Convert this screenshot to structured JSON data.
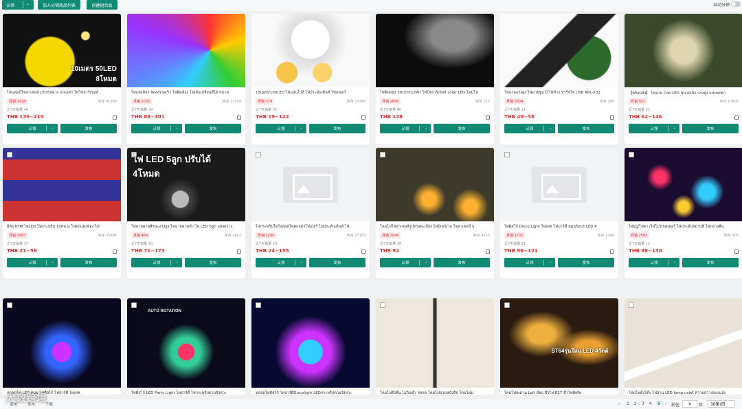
{
  "toolbar": {
    "claim_label": "认领",
    "add_label": "加入分销商品列表",
    "create_label": "创建组合品",
    "auto_label": "自动分销"
  },
  "card_labels": {
    "claim": "认领",
    "publish": "发布",
    "stock_prefix": "库存 ",
    "sold_prefix": "近7天销量 "
  },
  "cards": [
    {
      "title": "ไฟแคมป์โซล่าเซลล์ LED50ดวง 10เมตร ไฟโซลาร์เซลล์",
      "tag": "月销 1328",
      "stock": "41388",
      "sold": "40",
      "price": "THB 139~215",
      "img": "solar-lights",
      "ov": "10เมตร 50LED 8โหมด",
      "bg": "#111"
    },
    {
      "title": "ไฟแต่งห้อง จัดส่งรวดเร็ว ไฟติดห้อง ไฟเส้นเปลี่ยนสีได้ ขนาด",
      "tag": "月销 2035",
      "stock": "21924",
      "sold": "39",
      "price": "THB 88~301",
      "img": "led-strip",
      "ov": "",
      "bg": "#f4f4f4"
    },
    {
      "title": "15เมตร/100LED ไฟแอ่นไวท์ ไฟประดับเต็นท์ ไฟแคมป์",
      "tag": "月销 379",
      "stock": "20394",
      "sold": "35",
      "price": "THB 19~122",
      "img": "ball-lights",
      "ov": "",
      "bg": "#f8f8f8"
    },
    {
      "title": "ไฟติดผนัง 30LED(12W) ไฟโซลาร์เซลล์ solar LED โคมไฟ",
      "tag": "月销 2685",
      "stock": "125",
      "sold": "80",
      "price": "THB 138",
      "img": "wall-light",
      "ov": "",
      "bg": "#0c0c0c"
    },
    {
      "title": "ไฟฉายแรงสูง ไฟฉายซูม มี ไฟข้าง ชาร์จไฟ USB APL-X32",
      "tag": "月销 2304",
      "stock": "288",
      "sold": "11",
      "price": "THB 49~58",
      "img": "flashlight",
      "ov": "",
      "bg": "#fafafa"
    },
    {
      "title": "【พร้อมส่ง】 ไฟฉาย Cob LED ขนาดเล็ก แรงสูง แบบพกพา",
      "tag": "月销 921",
      "stock": "17800",
      "sold": "21",
      "price": "THB 62~146",
      "img": "cob-light",
      "ov": "",
      "bg": "#3b4a2a"
    },
    {
      "title": "ยี่ห้อ KTM ไฟLED ไฟกระพริบ 100ดวง ไฟตกแต่งห้อง ไฟ",
      "tag": "月销 2067",
      "stock": "35896",
      "sold": "37",
      "price": "THB 21~58",
      "img": "fairy-boxes",
      "ov": "",
      "bg": "#2a1a33"
    },
    {
      "title": "ไฟฉายคาดศีรษะแรงสูง ไฟฉายคาดหัว ไฟ LED 5ลูก แสงสว่าง",
      "tag": "月销 464",
      "stock": "2601",
      "sold": "10",
      "price": "THB 71~173",
      "img": "headlamp",
      "ov": "ไฟ LED 5ลูก ปรับได้ 4โหมด",
      "bg": "#1a1a1a"
    },
    {
      "title": "ไฟกระพริบไฟวิ่งหยดไฟตกแต่งไฟเธอรี่ ไฟประดับเต็นท์ ไฟ",
      "tag": "月销 1290",
      "stock": "27183",
      "sold": "59",
      "price": "THB 24~155",
      "img": "placeholder",
      "ov": "",
      "bg": ""
    },
    {
      "title": "โคมไฟโซล่าเซลล์รูปทรงตะเกียง ไฟปักสนาม โซลาเซลล์ S",
      "tag": "月销 1046",
      "stock": "4555",
      "sold": "28",
      "price": "THB 92",
      "img": "lantern",
      "ov": "",
      "bg": "#3d3a2a"
    },
    {
      "title": "ไฟดิสโก้ Disco Light ไฟเทค ไฟปาร์ตี้ หมุนร้อนร LED P",
      "tag": "月销 1732",
      "stock": "1246",
      "sold": "91",
      "price": "THB 96~121",
      "img": "placeholder",
      "ov": "",
      "bg": ""
    },
    {
      "title": "ไทยฎู/ไฟดาวไฟโปรเจคเตอร์ ไฟประดับสถานที่ ไฟกลางคืน",
      "tag": "月销 2563",
      "stock": "500",
      "sold": "11",
      "price": "THB 88~130",
      "img": "star-projector",
      "ov": "",
      "bg": "#1a0b30"
    },
    {
      "title": "หลอดไฟ LED หมุน ไฟดิสโก้ ไฟปาร์ตี้ ไฟเทค",
      "tag": "",
      "stock": "",
      "sold": "",
      "price": "",
      "img": "disco-bulb",
      "ov": "",
      "bg": "#0a0820"
    },
    {
      "title": "ไฟดิสโก้ LED Party Light ไฟปาร์ตี้ ไฟกระพริบตามจังหวะ",
      "tag": "",
      "stock": "",
      "sold": "",
      "price": "",
      "img": "party-light",
      "ov": "AUTO ROTATION",
      "bg": "#0a0a18"
    },
    {
      "title": "หลอดไฟดิสโก้ ไฟปาร์ตี้Discolight LEDกระพริบตามจังหวะ",
      "tag": "",
      "stock": "",
      "sold": "",
      "price": "",
      "img": "disco-ball",
      "ov": "",
      "bg": "#060a30"
    },
    {
      "title": "โคมไฟตั้งพื้น ไม่กินซ้ำ หลอด โคมไฟยามหนังสือ โคมไฟม่",
      "tag": "",
      "stock": "",
      "sold": "",
      "price": "",
      "img": "floor-lamp",
      "ov": "",
      "bg": "#ece6dc"
    },
    {
      "title": "โคมไฟเพดาน Loft ห้อย ขั้วไฟ E27 ขั้วไฟพิเศษ",
      "tag": "",
      "stock": "",
      "sold": "",
      "price": "",
      "img": "edison-bulb",
      "ov": "ST64รุ่นใหม่ LED 4วัตต์",
      "bg": "#2a1a10"
    },
    {
      "title": "โคมไฟตั้งโต๊ะ ไฟอ่าน LED lamp usbA ความสว่างของแสง",
      "tag": "",
      "stock": "",
      "sold": "",
      "price": "",
      "img": "desk-lamp",
      "ov": "",
      "bg": "#e8e2d8"
    }
  ],
  "pagination": {
    "prev": "‹",
    "pages": [
      "1",
      "2",
      "3",
      "4",
      "5"
    ],
    "current": "5",
    "next": "›",
    "goto_label": "前往",
    "goto_value": "5",
    "page_suffix": "页",
    "per_page": "30条/页"
  },
  "footer_left": [
    "审核",
    "发布",
    "下载"
  ],
  "watermark": "大数跨境",
  "colors": {
    "accent": "#108a73",
    "price": "#e62e2e"
  }
}
